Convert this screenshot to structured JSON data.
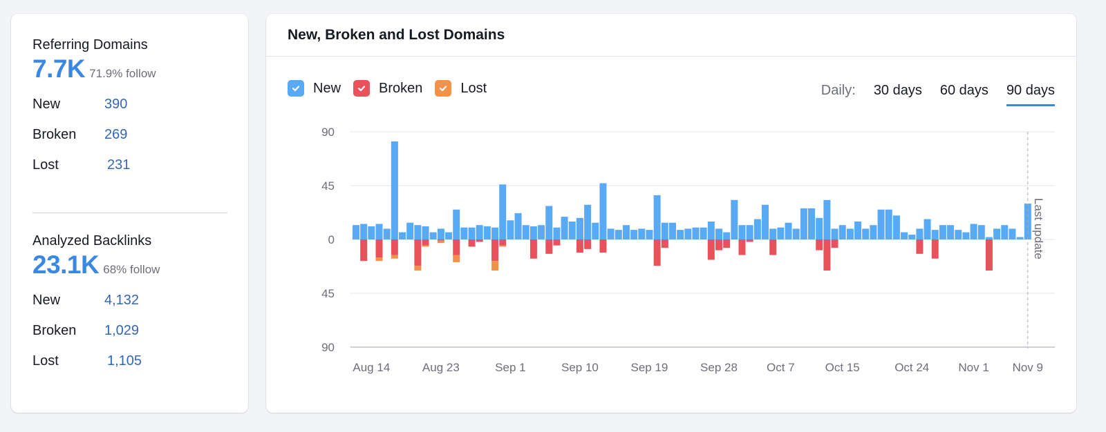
{
  "left_panel": {
    "referring_domains": {
      "title": "Referring Domains",
      "value": "7.7K",
      "follow": "71.9% follow",
      "stats": [
        {
          "label": "New",
          "value": "390"
        },
        {
          "label": "Broken",
          "value": "269"
        },
        {
          "label": "Lost",
          "value": "231"
        }
      ]
    },
    "analyzed_backlinks": {
      "title": "Analyzed Backlinks",
      "value": "23.1K",
      "follow": "68% follow",
      "stats": [
        {
          "label": "New",
          "value": "4,132"
        },
        {
          "label": "Broken",
          "value": "1,029"
        },
        {
          "label": "Lost",
          "value": "1,105"
        }
      ]
    }
  },
  "right_panel": {
    "title": "New, Broken and Lost Domains",
    "legend": [
      {
        "label": "New",
        "color": "#58aaf5",
        "checked": true,
        "icon": "check-icon"
      },
      {
        "label": "Broken",
        "color": "#e9525a",
        "checked": true,
        "icon": "check-icon"
      },
      {
        "label": "Lost",
        "color": "#f0924a",
        "checked": true,
        "icon": "check-icon"
      }
    ],
    "period": {
      "label": "Daily:",
      "options": [
        "30 days",
        "60 days",
        "90 days"
      ],
      "selected": "90 days"
    }
  },
  "colors": {
    "accent": "#3b88e3",
    "new": "#58aaf5",
    "broken": "#e9525a",
    "lost": "#f0924a",
    "link": "#3366b8"
  },
  "chart_data": {
    "type": "bar",
    "title": "New, Broken and Lost Domains",
    "xlabel": "",
    "ylabel": "",
    "ylim": [
      -90,
      90
    ],
    "yticks": [
      90,
      45,
      0,
      -45,
      -90
    ],
    "ytick_labels": [
      "90",
      "45",
      "0",
      "45",
      "90"
    ],
    "grid": true,
    "legend_position": "top-left",
    "stacked": true,
    "annotation": {
      "text": "Last update",
      "at_index": 87
    },
    "xtick_labels": [
      {
        "label": "Aug 14",
        "index": 2
      },
      {
        "label": "Aug 23",
        "index": 11
      },
      {
        "label": "Sep 1",
        "index": 20
      },
      {
        "label": "Sep 10",
        "index": 29
      },
      {
        "label": "Sep 19",
        "index": 38
      },
      {
        "label": "Sep 28",
        "index": 47
      },
      {
        "label": "Oct 7",
        "index": 55
      },
      {
        "label": "Oct 15",
        "index": 63
      },
      {
        "label": "Oct 24",
        "index": 72
      },
      {
        "label": "Nov 1",
        "index": 80
      },
      {
        "label": "Nov 9",
        "index": 87
      }
    ],
    "series": [
      {
        "name": "New",
        "values": [
          12,
          13,
          11,
          13,
          9,
          82,
          6,
          14,
          12,
          11,
          6,
          9,
          6,
          25,
          10,
          10,
          12,
          11,
          10,
          46,
          16,
          22,
          12,
          11,
          12,
          28,
          10,
          19,
          15,
          18,
          29,
          14,
          47,
          9,
          8,
          12,
          8,
          9,
          8,
          37,
          14,
          14,
          8,
          9,
          10,
          10,
          15,
          9,
          6,
          33,
          12,
          12,
          17,
          29,
          9,
          10,
          14,
          9,
          26,
          26,
          18,
          33,
          9,
          12,
          9,
          15,
          9,
          12,
          25,
          25,
          20,
          6,
          4,
          9,
          17,
          8,
          12,
          12,
          8,
          6,
          13,
          12,
          2,
          9,
          12,
          9,
          2,
          30
        ]
      },
      {
        "name": "Broken",
        "values": [
          0,
          18,
          0,
          15,
          0,
          13,
          0,
          0,
          22,
          5,
          0,
          1,
          0,
          13,
          0,
          6,
          2,
          0,
          18,
          5,
          0,
          0,
          0,
          16,
          0,
          12,
          5,
          0,
          0,
          11,
          8,
          0,
          11,
          0,
          0,
          0,
          0,
          0,
          0,
          22,
          7,
          0,
          0,
          0,
          0,
          0,
          17,
          9,
          7,
          0,
          13,
          2,
          0,
          0,
          13,
          0,
          0,
          0,
          0,
          0,
          9,
          26,
          7,
          0,
          0,
          0,
          0,
          0,
          0,
          0,
          0,
          0,
          0,
          12,
          0,
          16,
          0,
          0,
          0,
          0,
          0,
          0,
          26,
          0,
          0,
          0,
          0,
          0
        ]
      },
      {
        "name": "Lost",
        "values": [
          0,
          0,
          0,
          3,
          0,
          3,
          0,
          0,
          4,
          1,
          0,
          2,
          0,
          6,
          0,
          0,
          0,
          0,
          8,
          1,
          0,
          0,
          0,
          0,
          0,
          0,
          0,
          0,
          0,
          0,
          0,
          0,
          0,
          0,
          0,
          0,
          0,
          0,
          0,
          0,
          0,
          0,
          0,
          0,
          0,
          0,
          0,
          0,
          0,
          0,
          0,
          0,
          0,
          0,
          0,
          0,
          0,
          0,
          0,
          0,
          0,
          0,
          0,
          0,
          0,
          0,
          0,
          0,
          0,
          0,
          0,
          0,
          0,
          0,
          0,
          0,
          0,
          0,
          0,
          0,
          0,
          0,
          0,
          0,
          0,
          0,
          0,
          0
        ]
      }
    ]
  }
}
